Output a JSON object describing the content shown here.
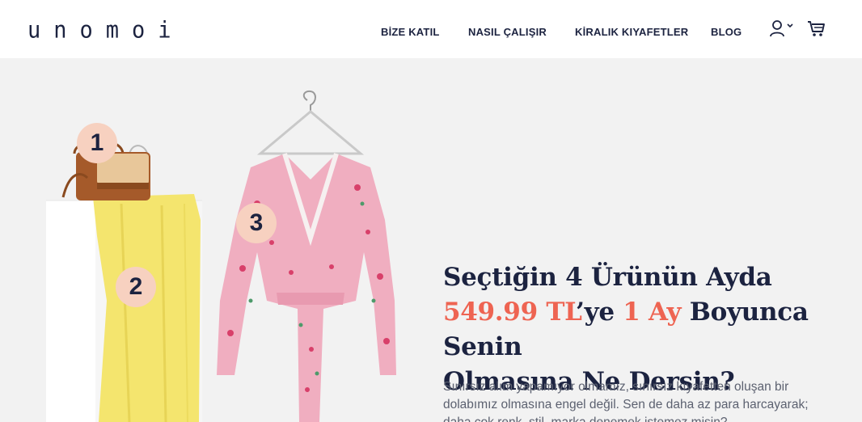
{
  "brand": {
    "logo": "unomoi"
  },
  "nav": {
    "items": [
      {
        "label": "BİZE KATIL"
      },
      {
        "label": "NASIL ÇALIŞIR"
      },
      {
        "label": "KİRALIK KIYAFETLER"
      },
      {
        "label": "BLOG"
      }
    ],
    "icons": [
      "user-icon",
      "cart-icon"
    ]
  },
  "hero": {
    "badges": [
      "1",
      "2",
      "3"
    ],
    "headline": {
      "line1": "Seçtiğin 4 Ürünün Ayda",
      "price": "549.99 TL",
      "mid": "’ye ",
      "duration": "1 Ay",
      "rest": " Boyunca Senin",
      "line3": "Olmasına Ne Dersin?"
    },
    "body": "Sınırsız alım yapamıyor olmamız, sınırsız kıyafetten oluşan bir dolabımız olmasına engel değil. Sen de daha az para harcayarak; daha çok renk, stil, marka denemek istemez misin?"
  },
  "colors": {
    "navy": "#1c2340",
    "accent": "#ee6452",
    "badge": "#f7d1c0",
    "background": "#f2f2f2"
  }
}
